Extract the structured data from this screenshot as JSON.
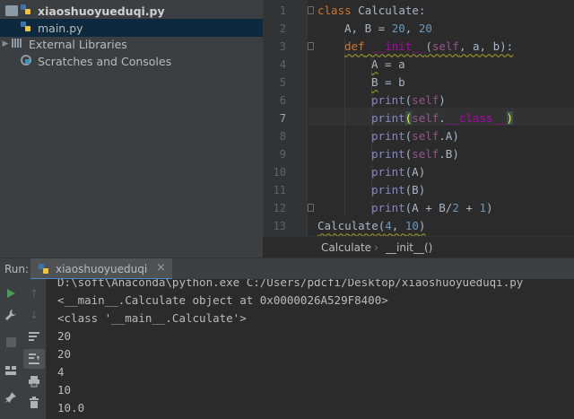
{
  "project_tree": {
    "items": [
      {
        "label": "xiaoshuoyueduqi.py",
        "icon": "python-file-icon"
      },
      {
        "label": "main.py",
        "icon": "python-file-icon"
      },
      {
        "label": "External Libraries",
        "icon": "library-icon"
      },
      {
        "label": "Scratches and Consoles",
        "icon": "scratches-icon"
      }
    ]
  },
  "editor": {
    "line_numbers": [
      "1",
      "2",
      "3",
      "4",
      "5",
      "6",
      "7",
      "8",
      "9",
      "10",
      "11",
      "12",
      "13"
    ],
    "current_line": "7",
    "code": {
      "l1_kw": "class",
      "l1_rest": " Calculate:",
      "l2_a": "A, B = ",
      "l2_n1": "20",
      "l2_c": ", ",
      "l2_n2": "20",
      "l3_kw": "def",
      "l3_sp": " ",
      "l3_fn": "__init__",
      "l3_p1": "(",
      "l3_self": "self",
      "l3_rest": ", a, b):",
      "l4_a": "A",
      "l4_rest": " = a",
      "l5_a": "B",
      "l5_rest": " = b",
      "l6_fn": "print",
      "l6_p1": "(",
      "l6_self": "self",
      "l6_p2": ")",
      "l7_fn": "print",
      "l7_p1": "(",
      "l7_self": "self",
      "l7_dot": ".",
      "l7_attr": "__class__",
      "l7_p2": ")",
      "l8_fn": "print",
      "l8_p1": "(",
      "l8_self": "self",
      "l8_rest": ".A)",
      "l9_fn": "print",
      "l9_p1": "(",
      "l9_self": "self",
      "l9_rest": ".B)",
      "l10_fn": "print",
      "l10_rest": "(A)",
      "l11_fn": "print",
      "l11_rest": "(B)",
      "l12_fn": "print",
      "l12_a": "(A + B/",
      "l12_n1": "2",
      "l12_b": " + ",
      "l12_n2": "1",
      "l12_c": ")",
      "l13_a": "Calculate(",
      "l13_n1": "4",
      "l13_c": ", ",
      "l13_n2": "10",
      "l13_p": ")"
    }
  },
  "breadcrumb": {
    "class_name": "Calculate",
    "separator": "›",
    "method": "__init__()"
  },
  "run_panel": {
    "label": "Run:",
    "tab_name": "xiaoshuoyueduqi",
    "close": "×",
    "output": [
      "D:\\soft\\Anaconda\\python.exe C:/Users/pdcfi/Desktop/xiaoshuoyueduqi.py",
      "<__main__.Calculate object at 0x0000026A529F8400>",
      "<class '__main__.Calculate'>",
      "20",
      "20",
      "4",
      "10",
      "10.0"
    ]
  },
  "colors": {
    "accent": "#3592c4",
    "run_green": "#499c54",
    "selection": "#0d293e"
  }
}
